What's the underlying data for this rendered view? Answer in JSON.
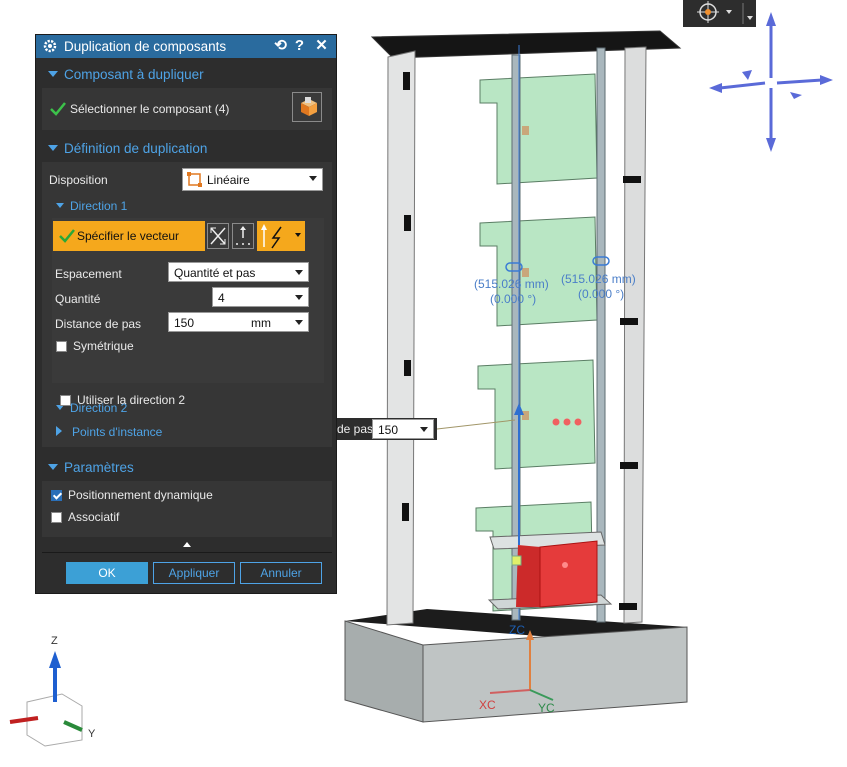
{
  "dialog": {
    "title": "Duplication de composants",
    "title_buttons": [
      "reset-icon",
      "help-icon",
      "close-icon"
    ],
    "section_component": {
      "title": "Composant à dupliquer",
      "select_label": "Sélectionner le composant (4)"
    },
    "section_definition": {
      "title": "Définition de duplication",
      "layout_label": "Disposition",
      "layout_value": "Linéaire",
      "direction1": {
        "title": "Direction 1",
        "vector_label": "Spécifier le vecteur",
        "spacing_label": "Espacement",
        "spacing_value": "Quantité et pas",
        "quantity_label": "Quantité",
        "quantity_value": "4",
        "pitch_label": "Distance de pas",
        "pitch_value": "150",
        "pitch_unit": "mm",
        "symmetric_label": "Symétrique",
        "symmetric_checked": false
      },
      "direction2": {
        "title": "Direction 2",
        "use_label": "Utiliser la direction 2",
        "use_checked": false
      },
      "instance_points_title": "Points d'instance"
    },
    "section_params": {
      "title": "Paramètres",
      "dynamic_label": "Positionnement dynamique",
      "dynamic_checked": true,
      "associative_label": "Associatif",
      "associative_checked": false
    },
    "buttons": {
      "ok": "OK",
      "apply": "Appliquer",
      "cancel": "Annuler"
    }
  },
  "viewport": {
    "float_field": {
      "label": "de pas",
      "value": "150"
    },
    "dim1": {
      "length": "(515.026 mm)",
      "angle": "(0.000 °)"
    },
    "dim2": {
      "length": "(515.026 mm)",
      "angle": "(0.000 °)"
    },
    "axis_labels": {
      "xc": "XC",
      "yc": "YC",
      "zc": "ZC"
    },
    "triad_labels": {
      "z": "Z",
      "y": "Y"
    }
  },
  "colors": {
    "accent": "#4ea3e6",
    "title_bar": "#2a6b9e",
    "highlight": "#f5a81c",
    "panel": "#2d2d2d",
    "plate_green": "#b9e6c4",
    "red_block": "#e53b3b"
  }
}
